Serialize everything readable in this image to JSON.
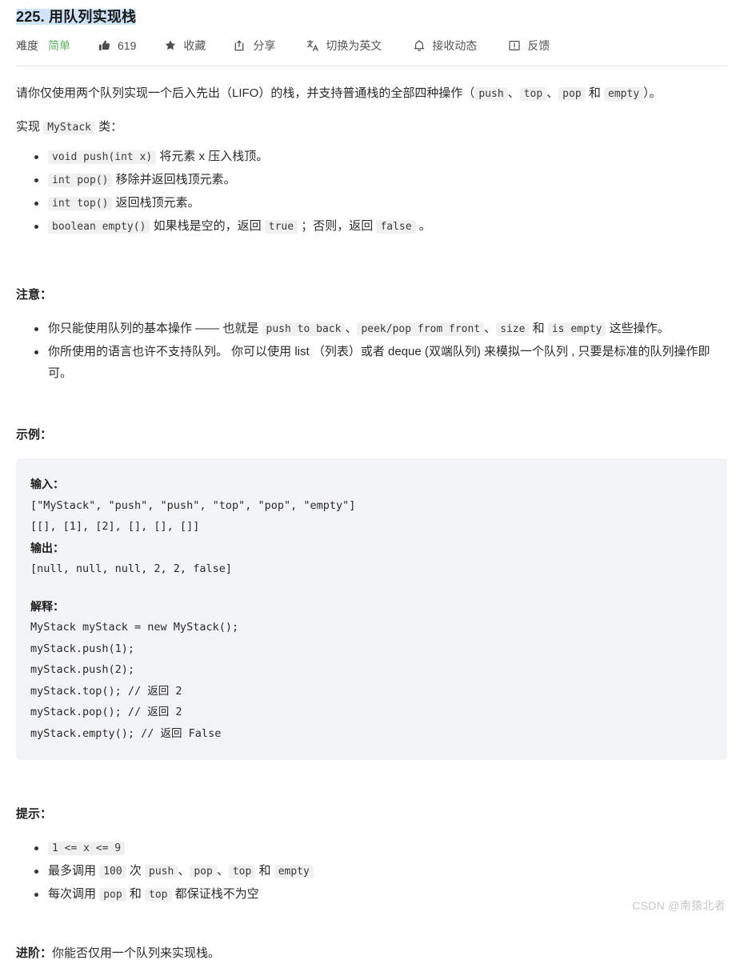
{
  "header": {
    "title": "225. 用队列实现栈",
    "difficulty_label": "难度",
    "difficulty_value": "简单",
    "like_count": "619",
    "favorite_label": "收藏",
    "share_label": "分享",
    "translate_label": "切换为英文",
    "subscribe_label": "接收动态",
    "feedback_label": "反馈",
    "accent_color": "#5eb95e",
    "title_highlight_color": "#cfe4f7"
  },
  "description": {
    "intro_1": "请你仅使用两个队列实现一个后入先出（LIFO）的栈，并支持普通栈的全部四种操作（",
    "code_push": "push",
    "sep_1": "、",
    "code_top": "top",
    "sep_2": "、",
    "code_pop": "pop",
    "conj": "和",
    "code_empty": "empty",
    "intro_2": "）。",
    "impl_prefix": "实现",
    "impl_class": "MyStack",
    "impl_suffix": "类：",
    "methods": [
      {
        "code": "void push(int x)",
        "text": "将元素 x 压入栈顶。"
      },
      {
        "code": "int pop()",
        "text": "移除并返回栈顶元素。"
      },
      {
        "code": "int top()",
        "text": "返回栈顶元素。"
      },
      {
        "code": "boolean empty()",
        "text_a": "如果栈是空的，返回",
        "code_a": "true",
        "text_b": "；否则，返回",
        "code_b": "false",
        "text_c": "。"
      }
    ]
  },
  "notes": {
    "heading": "注意：",
    "item1": {
      "prefix": "你只能使用队列的基本操作 —— 也就是",
      "c1": "push to back",
      "s1": "、",
      "c2": "peek/pop from front",
      "s2": "、",
      "c3": "size",
      "conj": "和",
      "c4": "is empty",
      "suffix": "这些操作。"
    },
    "item2": "你所使用的语言也许不支持队列。 你可以使用 list （列表）或者 deque (双端队列) 来模拟一个队列 , 只要是标准的队列操作即可。"
  },
  "example": {
    "heading": "示例：",
    "input_label": "输入：",
    "input_lines": [
      "[\"MyStack\", \"push\", \"push\", \"top\", \"pop\", \"empty\"]",
      "[[], [1], [2], [], [], []]"
    ],
    "output_label": "输出：",
    "output_lines": [
      "[null, null, null, 2, 2, false]"
    ],
    "explain_label": "解释：",
    "explain_lines": [
      "MyStack myStack = new MyStack();",
      "myStack.push(1);",
      "myStack.push(2);",
      "myStack.top(); // 返回 2",
      "myStack.pop(); // 返回 2",
      "myStack.empty(); // 返回 False"
    ]
  },
  "hints": {
    "heading": "提示：",
    "item1_code": "1 <= x <= 9",
    "item2": {
      "prefix": "最多调用",
      "count": "100",
      "mid": "次",
      "c1": "push",
      "s1": "、",
      "c2": "pop",
      "s2": "、",
      "c3": "top",
      "conj": "和",
      "c4": "empty"
    },
    "item3": {
      "prefix": "每次调用",
      "c1": "pop",
      "conj": "和",
      "c2": "top",
      "suffix": "都保证栈不为空"
    }
  },
  "advanced": {
    "label": "进阶：",
    "text": "你能否仅用一个队列来实现栈。"
  },
  "watermark": "CSDN @南猿北者"
}
